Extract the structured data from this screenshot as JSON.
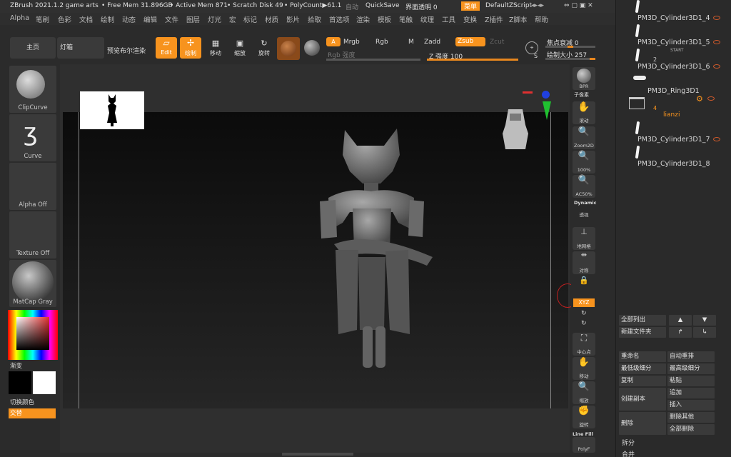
{
  "title_bar": {
    "app": "ZBrush 2021.1.2 game arts",
    "free_mem": "• Free Mem 31.896GB",
    "active_mem": "• Active Mem 871",
    "scratch": "• Scratch Disk 49",
    "polycount": "• PolyCount▶61.1",
    "auto": "自动",
    "quicksave": "QuickSave",
    "interface_transparency": "界面透明 0",
    "menus": "菜单",
    "script": "DefaultZScript"
  },
  "menu_bar": [
    "Alpha",
    "笔刷",
    "色彩",
    "文档",
    "绘制",
    "动态",
    "编辑",
    "文件",
    "图层",
    "灯光",
    "宏",
    "标记",
    "材质",
    "影片",
    "拾取",
    "首选项",
    "渲染",
    "模板",
    "笔触",
    "纹理",
    "工具",
    "变换",
    "Z插件",
    "Z脚本",
    "帮助"
  ],
  "toolbar": {
    "home": "主页",
    "lightbox": "灯箱",
    "preview_boolean": "预览布尔渲染",
    "edit": "Edit",
    "draw": "绘制",
    "move": "移动",
    "scale": "缩放",
    "rotate": "旋转",
    "a": "A",
    "mrgb": "Mrgb",
    "rgb": "Rgb",
    "m": "M",
    "zadd": "Zadd",
    "zsub": "Zsub",
    "zcut": "Zcut",
    "rgb_intensity": "Rgb 强度",
    "z_intensity": "Z 强度 100",
    "focal_shift": "焦点衰减 0",
    "draw_size": "绘制大小 257",
    "rgb_intensity_level": 0,
    "z_intensity_level": 1.0,
    "focal_shift_level": 0.5,
    "draw_size_level": 0.25
  },
  "left_panel": {
    "clipcurve": "ClipCurve",
    "curve": "Curve",
    "alpha": "Alpha Off",
    "texture": "Texture Off",
    "material": "MatCap Gray",
    "gradient": "渐变",
    "switch_color": "切换颜色",
    "alternate": "交替"
  },
  "right_tools": [
    "BPR",
    "子像素",
    "滚动",
    "Zoom2D",
    "100%",
    "AC50%",
    "Dynamic",
    "透视",
    "地网格",
    "对称",
    "XYZ",
    "中心点",
    "移动",
    "缩放",
    "旋转",
    "Line Fill",
    "PolyF"
  ],
  "subtools": {
    "items": [
      {
        "name": "PM3D_Cylinder3D1_4"
      },
      {
        "name": "PM3D_Cylinder3D1_5"
      },
      {
        "name": "PM3D_Cylinder3D1_6"
      },
      {
        "name": "PM3D_Ring3D1"
      },
      {
        "name": "lianzi"
      },
      {
        "name": "PM3D_Cylinder3D1_7"
      },
      {
        "name": "PM3D_Cylinder3D1_8"
      }
    ],
    "start_label": "START",
    "count_2": "2",
    "folder_count": "4"
  },
  "subtool_actions": {
    "list_all": "全部列出",
    "new_folder": "新建文件夹",
    "rename": "重命名",
    "auto_reorder": "自动重排",
    "lowest_sub": "最低级细分",
    "highest_sub": "最高级细分",
    "duplicate": "复制",
    "paste": "粘贴",
    "create_copy": "创建副本",
    "append": "追加",
    "insert": "插入",
    "delete": "删除",
    "delete_other": "删除其他",
    "delete_all": "全部删除",
    "split": "拆分",
    "merge": "合并"
  },
  "colors": {
    "accent": "#f7931e",
    "primary_color": "#000000",
    "secondary_color": "#ffffff"
  }
}
